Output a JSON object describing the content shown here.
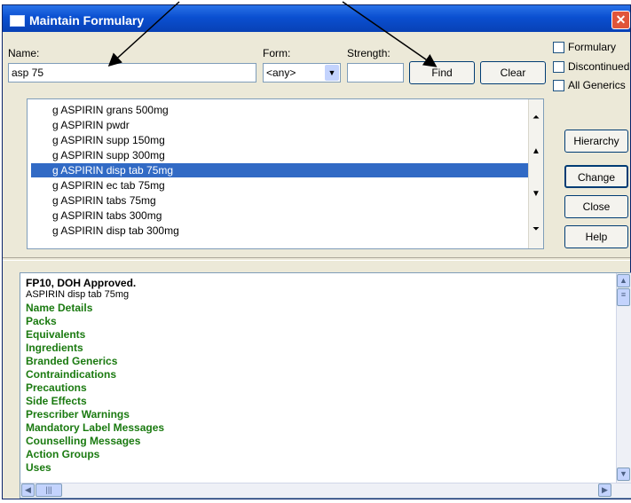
{
  "window": {
    "title": "Maintain Formulary"
  },
  "search": {
    "name_label": "Name:",
    "name_value": "asp 75",
    "form_label": "Form:",
    "form_value": "<any>",
    "strength_label": "Strength:",
    "strength_value": ""
  },
  "buttons": {
    "find": "Find",
    "clear": "Clear",
    "hierarchy": "Hierarchy",
    "change": "Change",
    "close": "Close",
    "help": "Help"
  },
  "filters": {
    "formulary": "Formulary",
    "discontinued": "Discontinued",
    "all_generics": "All Generics"
  },
  "results": [
    "g ASPIRIN grans 500mg",
    "g ASPIRIN pwdr",
    "g ASPIRIN supp 150mg",
    "g ASPIRIN supp 300mg",
    "g ASPIRIN disp tab 75mg",
    "g ASPIRIN ec tab 75mg",
    "g ASPIRIN tabs 75mg",
    "g ASPIRIN tabs 300mg",
    "g ASPIRIN disp tab 300mg"
  ],
  "selected_result": "g ASPIRIN disp tab 75mg",
  "detail": {
    "approval": "FP10, DOH Approved.",
    "product": "ASPIRIN disp tab 75mg",
    "sections": [
      "Name Details",
      "Packs",
      "Equivalents",
      "Ingredients",
      "Branded Generics",
      "Contraindications",
      "Precautions",
      "Side Effects",
      "Prescriber Warnings",
      "Mandatory Label Messages",
      "Counselling Messages",
      "Action Groups",
      "Uses"
    ]
  },
  "colors": {
    "titlebar": "#0a4fd0",
    "selection": "#316ac5",
    "section_text": "#1a7a10"
  }
}
